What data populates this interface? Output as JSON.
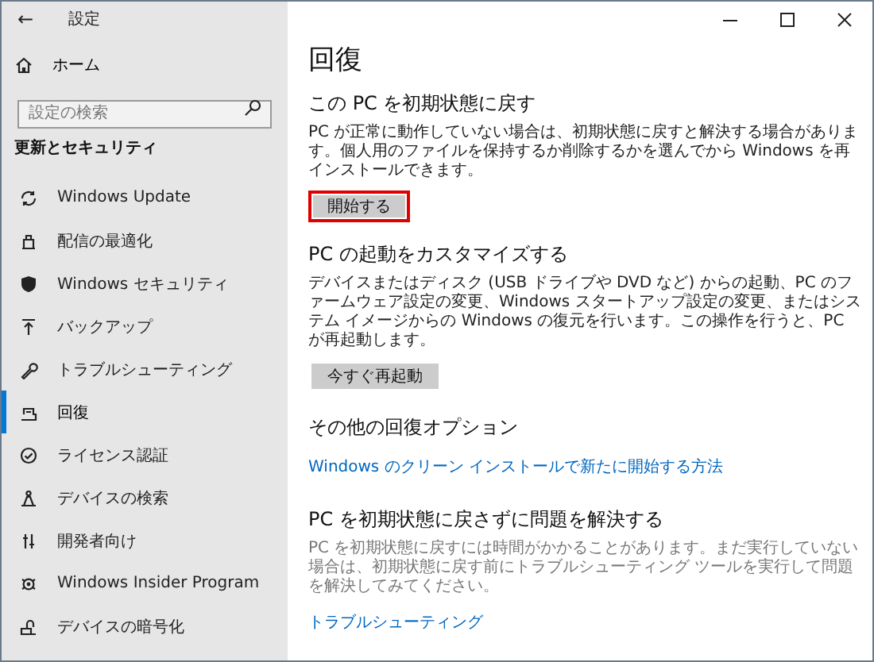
{
  "window": {
    "title": "設定",
    "back": "←"
  },
  "sidebar": {
    "home": "ホーム",
    "search": {
      "placeholder": "設定の検索"
    },
    "heading": "更新とセキュリティ",
    "items": [
      {
        "label": "Windows Update",
        "selected": false
      },
      {
        "label": "配信の最適化",
        "selected": false
      },
      {
        "label": "Windows セキュリティ",
        "selected": false
      },
      {
        "label": "バックアップ",
        "selected": false
      },
      {
        "label": "トラブルシューティング",
        "selected": false
      },
      {
        "label": "回復",
        "selected": true
      },
      {
        "label": "ライセンス認証",
        "selected": false
      },
      {
        "label": "デバイスの検索",
        "selected": false
      },
      {
        "label": "開発者向け",
        "selected": false
      },
      {
        "label": "Windows Insider Program",
        "selected": false
      },
      {
        "label": "デバイスの暗号化",
        "selected": false
      }
    ]
  },
  "page": {
    "title": "回復",
    "sections": [
      {
        "heading": "この PC を初期状態に戻す",
        "text": "PC が正常に動作していない場合は、初期状態に戻すと解決する場合があります。個人用のファイルを保持するか削除するかを選んでから Windows を再インストールできます。",
        "muted": false,
        "button": {
          "label": "開始する",
          "highlighted": true
        }
      },
      {
        "heading": "PC の起動をカスタマイズする",
        "text": "デバイスまたはディスク (USB ドライブや DVD など) からの起動、PC のファームウェア設定の変更、Windows スタートアップ設定の変更、またはシステム イメージからの Windows の復元を行います。この操作を行うと、PC が再起動します。",
        "muted": false,
        "button": {
          "label": "今すぐ再起動",
          "highlighted": false
        }
      },
      {
        "heading": "その他の回復オプション",
        "link": "Windows のクリーン インストールで新たに開始する方法"
      },
      {
        "heading": "PC を初期状態に戻さずに問題を解決する",
        "text": "PC を初期状態に戻すには時間がかかることがあります。まだ実行していない場合は、初期状態に戻す前にトラブルシューティング ツールを実行して問題を解決してみてください。",
        "muted": true,
        "link": "トラブルシューティング"
      }
    ]
  }
}
